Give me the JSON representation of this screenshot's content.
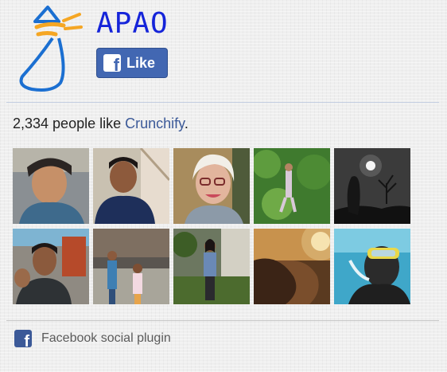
{
  "brand": {
    "name": "APAO",
    "logo_icon": "apao-logo-icon",
    "color": "#1524d9"
  },
  "like_button": {
    "icon": "facebook-f-icon",
    "label": "Like",
    "color": "#4267b2"
  },
  "summary": {
    "count": "2,334",
    "text_middle": " people like ",
    "page_link": "Crunchify",
    "text_end": "."
  },
  "friends": [
    {
      "alt": "friend-avatar-1"
    },
    {
      "alt": "friend-avatar-2"
    },
    {
      "alt": "friend-avatar-3"
    },
    {
      "alt": "friend-avatar-4"
    },
    {
      "alt": "friend-avatar-5"
    },
    {
      "alt": "friend-avatar-6"
    },
    {
      "alt": "friend-avatar-7"
    },
    {
      "alt": "friend-avatar-8"
    },
    {
      "alt": "friend-avatar-9"
    },
    {
      "alt": "friend-avatar-10"
    }
  ],
  "footer": {
    "icon": "facebook-icon",
    "label": "Facebook social plugin"
  },
  "colors": {
    "link": "#3b5998",
    "logo_orange": "#f5a623",
    "logo_blue": "#1b6fd1"
  }
}
